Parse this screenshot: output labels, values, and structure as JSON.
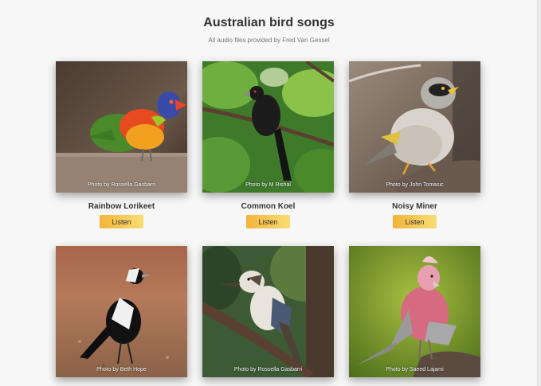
{
  "header": {
    "title": "Australian bird songs",
    "subtitle": "All audio files provided by Fred Van Gessel"
  },
  "birds": [
    {
      "name": "Rainbow Lorikeet",
      "credit": "Photo by Rossella Gasbarri",
      "button": "Listen"
    },
    {
      "name": "Common Koel",
      "credit": "Photo by M Rishal",
      "button": "Listen"
    },
    {
      "name": "Noisy Miner",
      "credit": "Photo by John Tomasic",
      "button": "Listen"
    },
    {
      "name": "",
      "credit": "Photo by Beth Hope",
      "button": ""
    },
    {
      "name": "",
      "credit": "Photo by Rossella Gasbarri",
      "button": ""
    },
    {
      "name": "",
      "credit": "Photo by Saeed Lajami",
      "button": ""
    }
  ],
  "colors": {
    "button_start": "#f3b43a",
    "button_end": "#f8dd74",
    "background": "#f7f7f7"
  }
}
